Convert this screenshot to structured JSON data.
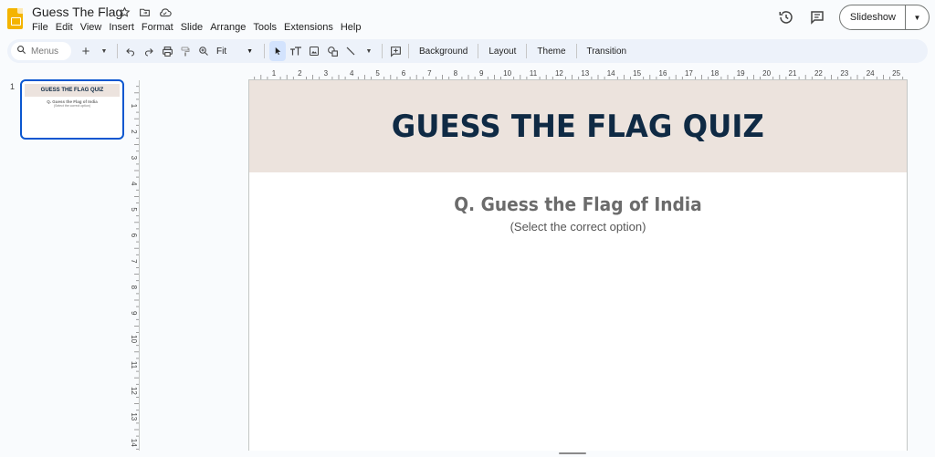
{
  "app": {
    "document_title": "Guess The Flag",
    "menus": [
      "File",
      "Edit",
      "View",
      "Insert",
      "Format",
      "Slide",
      "Arrange",
      "Tools",
      "Extensions",
      "Help"
    ],
    "slideshow_label": "Slideshow"
  },
  "toolbar": {
    "search_placeholder": "Menus",
    "zoom_value": "Fit",
    "background_label": "Background",
    "layout_label": "Layout",
    "theme_label": "Theme",
    "transition_label": "Transition"
  },
  "filmstrip": {
    "slide_number": "1",
    "thumb_title": "GUESS THE FLAG QUIZ",
    "thumb_question": "Q. Guess the Flag of India",
    "thumb_sub": "(Select the correct option)"
  },
  "slide": {
    "title": "GUESS THE FLAG QUIZ",
    "question": "Q. Guess the Flag of India",
    "instruction": "(Select the correct option)",
    "header_color": "#ece3dd",
    "title_color": "#0f2a44"
  },
  "rulers": {
    "horizontal_labels": [
      "1",
      "2",
      "3",
      "4",
      "5",
      "6",
      "7",
      "8",
      "9",
      "10",
      "11",
      "12",
      "13",
      "14",
      "15",
      "16",
      "17",
      "18",
      "19",
      "20",
      "21",
      "22",
      "23",
      "24",
      "25"
    ],
    "vertical_labels": [
      "1",
      "2",
      "3",
      "4",
      "5",
      "6",
      "7",
      "8",
      "9",
      "10",
      "11",
      "12",
      "13",
      "14"
    ]
  }
}
